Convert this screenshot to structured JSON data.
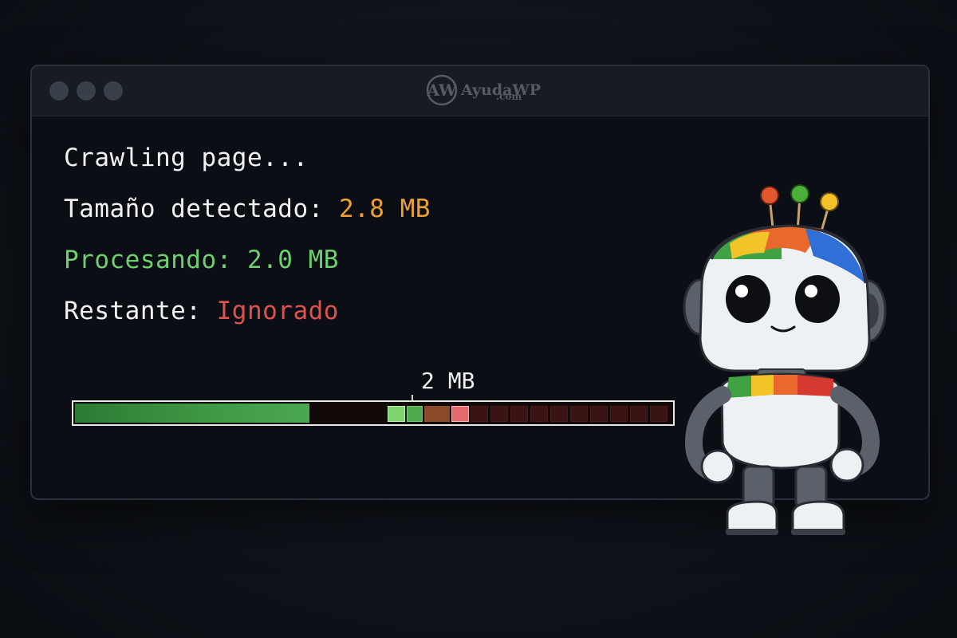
{
  "window": {
    "logo_name": "AyudaWP",
    "logo_domain": ".com"
  },
  "terminal": {
    "line1": "Crawling page...",
    "line2_label": "Tamaño detectado: ",
    "line2_value": "2.8 MB",
    "line3": "Procesando: 2.0 MB",
    "line4_label": "Restante: ",
    "line4_value": "Ignorado"
  },
  "progress": {
    "marker_label": "2 MB",
    "processed_fraction": 0.714,
    "total_mb": 2.8,
    "limit_mb": 2.0
  },
  "colors": {
    "accent_orange": "#f0a030",
    "accent_green": "#6fd06f",
    "accent_red": "#e0524f",
    "background": "#0b0e14"
  },
  "icons": {
    "window_controls": "traffic-light-dots",
    "mascot": "googlebot-robot"
  }
}
